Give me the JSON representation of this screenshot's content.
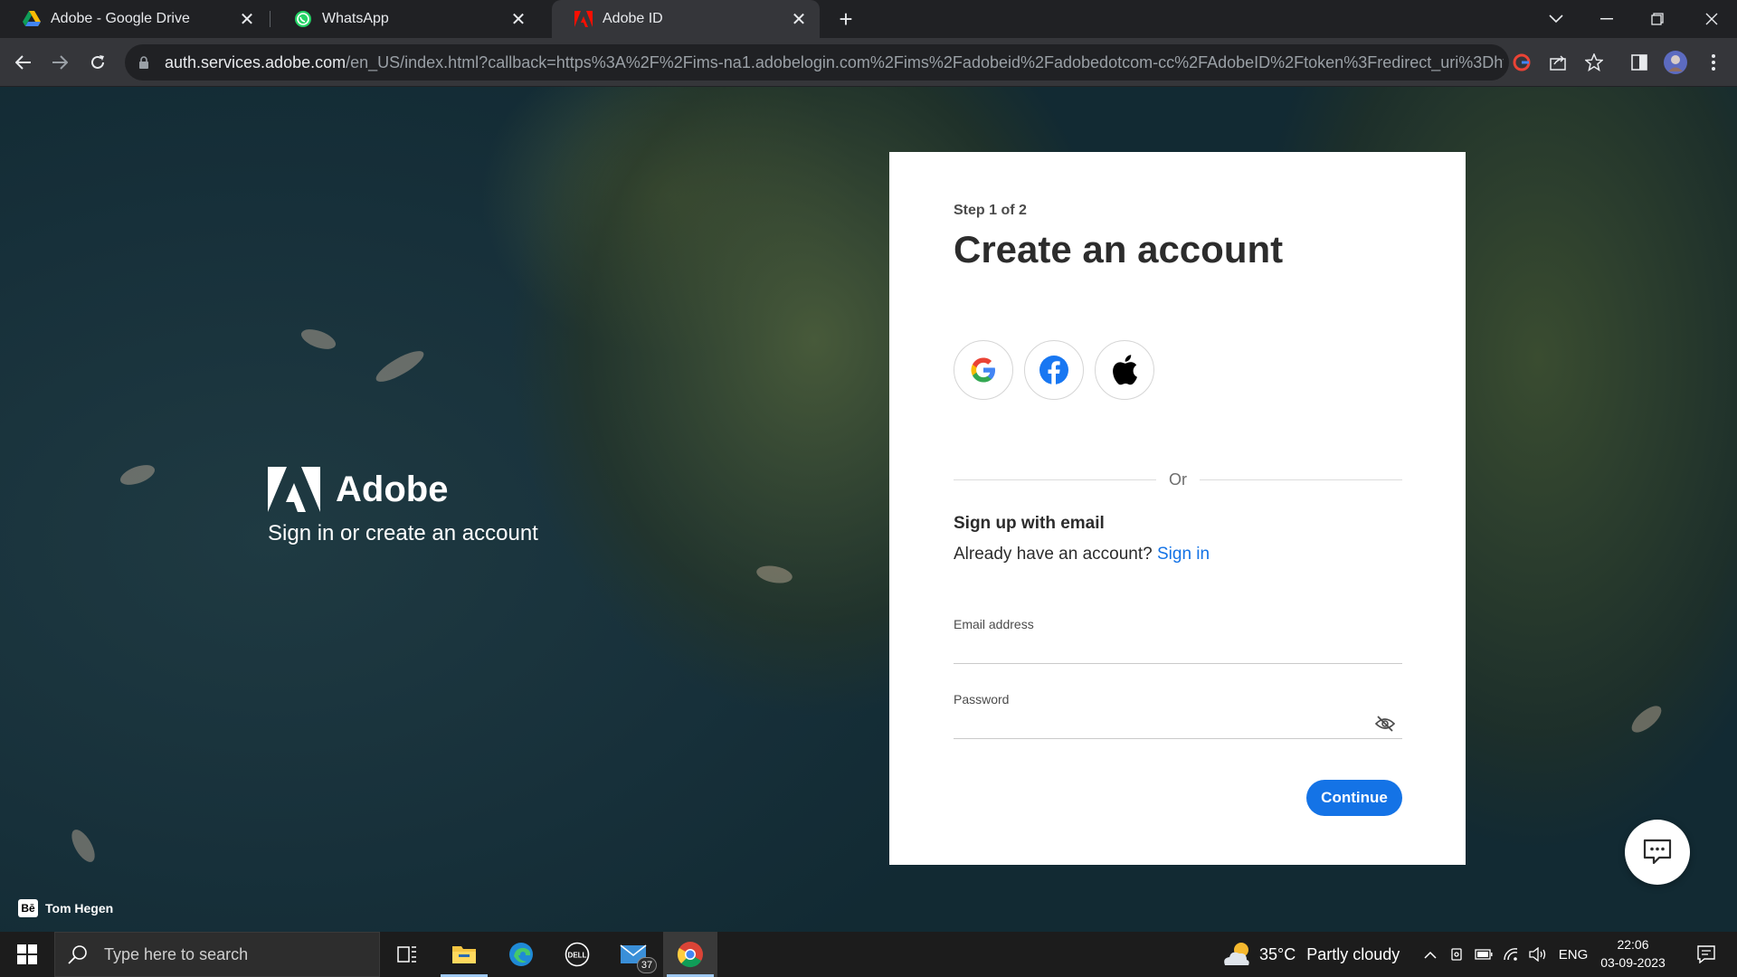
{
  "browser": {
    "tabs": [
      {
        "title": "Adobe - Google Drive",
        "favicon": "google-drive-icon",
        "active": false
      },
      {
        "title": "WhatsApp",
        "favicon": "whatsapp-icon",
        "active": false
      },
      {
        "title": "Adobe ID",
        "favicon": "adobe-icon",
        "active": true
      }
    ],
    "url_host": "auth.services.adobe.com",
    "url_path": "/en_US/index.html?callback=https%3A%2F%2Fims-na1.adobelogin.com%2Fims%2Fadobeid%2Fadobedotcom-cc%2FAdobeID%2Ftoken%3Fredirect_uri%3Dhttps%25..."
  },
  "brand": {
    "name": "Adobe",
    "tagline": "Sign in or create an account"
  },
  "card": {
    "step": "Step 1 of 2",
    "heading": "Create an account",
    "social": [
      "google-icon",
      "facebook-icon",
      "apple-icon"
    ],
    "or_label": "Or",
    "signup_title": "Sign up with email",
    "have_account": "Already have an account?",
    "signin_link": "Sign in",
    "email_label": "Email address",
    "email_value": "",
    "password_label": "Password",
    "password_value": "",
    "continue_label": "Continue"
  },
  "credit": {
    "badge": "Bē",
    "name": "Tom Hegen"
  },
  "taskbar": {
    "search_placeholder": "Type here to search",
    "mail_badge": "37",
    "weather_temp": "35°C",
    "weather_text": "Partly cloudy",
    "language": "ENG",
    "time": "22:06",
    "date": "03-09-2023"
  },
  "colors": {
    "accent": "#1473e6",
    "tab_active": "#35363a",
    "chrome_bg": "#202124"
  }
}
